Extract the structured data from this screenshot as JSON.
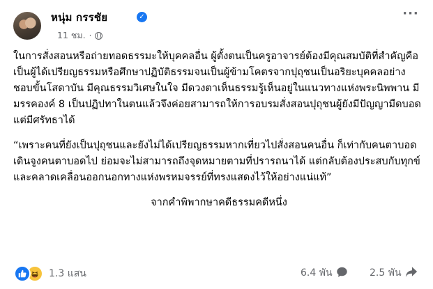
{
  "post": {
    "author": "หนุ่ม กรรชัย",
    "time": "11 ชม.",
    "dot": "·",
    "paragraphs": [
      "ในการสั่งสอนหรือถ่ายทอดธรรมะให้บุคคลอื่น ผู้ตั้งตนเป็นครูอาจารย์ต้องมีคุณสมบัติที่สำคัญคือ เป็นผู้ได้เปรียญธรรมหรือศึกษาปฏิบัติธรรมจนเป็นผู้ข้ามโคตรจากปุถุชนเป็นอริยะบุคคลอย่างชอบขั้นโสดาบัน มีคุณธรรมวิเศษในใจ มีดวงตาเห็นธรรมรู้เห็นอยู่ในแนวทางแห่งพระนิพพาน มีมรรคองค์ 8 เป็นปฏิปทาในตนแล้วจึงค่อยสามารถให้การอบรมสั่งสอนปุถุชนผู้ยังมีปัญญามืดบอดแต่มีศรัทธาได้",
      "“เพราะคนที่ยังเป็นปุถุชนและยังไม่ได้เปรียญธรรมหากเที่ยวไปสั่งสอนคนอื่น ก็เท่ากับคนตาบอดเดินจูงคนตาบอดไป ย่อมจะไม่สามารถถึงจุดหมายตามที่ปรารถนาได้ แต่กลับต้องประสบกับทุกข์และคลาดเคลื่อนออกนอกทางแห่งพรหมจรรย์ที่ทรงแสดงไว้ให้อย่างแน่แท้”",
      "จากคำพิพากษาคดีธรรมคดีหนึ่ง"
    ]
  },
  "footer": {
    "reaction_count": "1.3 แสน",
    "comments_count": "6.4 พัน",
    "shares_count": "2.5 พัน"
  },
  "colors": {
    "accent": "#1877f2",
    "secondary_text": "#65676b",
    "haha": "#f7c33c"
  },
  "icons": [
    "verified-badge-icon",
    "globe-icon",
    "more-options-icon",
    "like-reaction-icon",
    "haha-reaction-icon",
    "comment-icon",
    "share-icon"
  ]
}
